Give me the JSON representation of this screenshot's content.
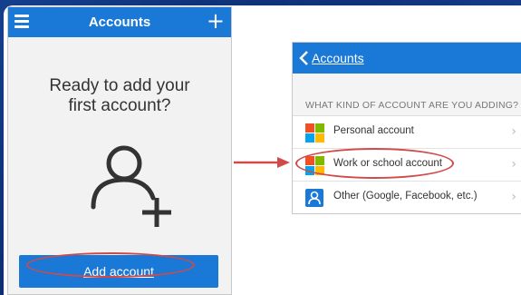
{
  "left_screen": {
    "header": {
      "title": "Accounts",
      "menu_icon": "hamburger-menu-icon",
      "add_icon": "plus-icon",
      "add_symbol": "+"
    },
    "prompt_line1": "Ready to add your",
    "prompt_line2": "first account?",
    "avatar_icon": "add-person-icon",
    "add_button_label": "Add account"
  },
  "right_screen": {
    "header": {
      "back_label": "Accounts",
      "back_icon": "chevron-left-icon"
    },
    "section_title": "WHAT KIND OF ACCOUNT ARE YOU ADDING?",
    "options": [
      {
        "label": "Personal account",
        "icon": "microsoft-logo-icon"
      },
      {
        "label": "Work or school account",
        "icon": "microsoft-logo-icon"
      },
      {
        "label": "Other (Google, Facebook, etc.)",
        "icon": "person-icon"
      }
    ],
    "chevron": "›"
  },
  "colors": {
    "accent": "#1a78d6",
    "highlight": "#d04a4a",
    "ms_red": "#f25022",
    "ms_green": "#7fba00",
    "ms_blue": "#00a4ef",
    "ms_yellow": "#ffb900"
  }
}
